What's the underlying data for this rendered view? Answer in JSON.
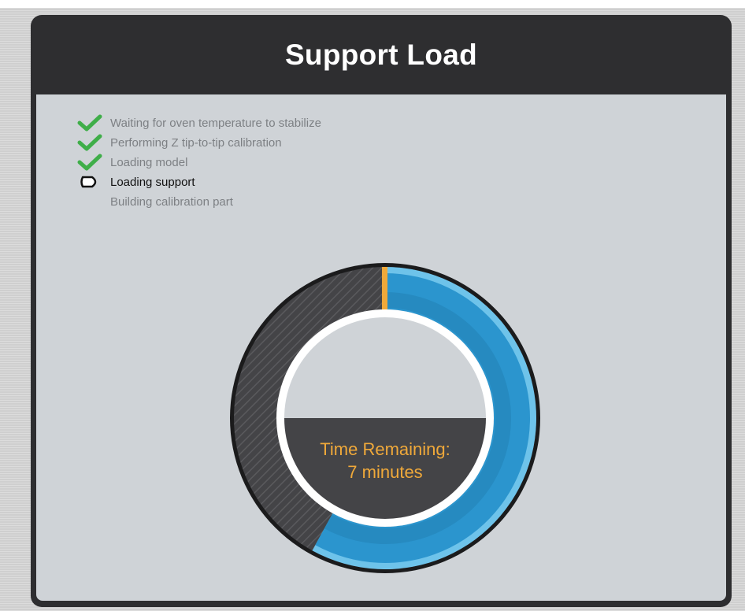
{
  "dialog": {
    "title": "Support Load"
  },
  "steps": [
    {
      "label": "Waiting for oven temperature to stabilize",
      "status": "done",
      "icon": "check-icon"
    },
    {
      "label": "Performing Z tip-to-tip calibration",
      "status": "done",
      "icon": "check-icon"
    },
    {
      "label": "Loading model",
      "status": "done",
      "icon": "check-icon"
    },
    {
      "label": "Loading support",
      "status": "current",
      "icon": "current-step-pointer-icon"
    },
    {
      "label": "Building calibration part",
      "status": "pending",
      "icon": ""
    }
  ],
  "progress": {
    "fraction_complete": 0.58,
    "time_label": "Time Remaining:",
    "time_value": "7 minutes"
  },
  "colors": {
    "panel_frame": "#2e2e30",
    "panel_body": "#cfd3d7",
    "check": "#3fae49",
    "progress_fill": "#2b95ce",
    "progress_rim": "#6ec3ea",
    "remaining_track": "#444447",
    "start_marker": "#f0a93a",
    "time_text": "#f0a93a"
  }
}
